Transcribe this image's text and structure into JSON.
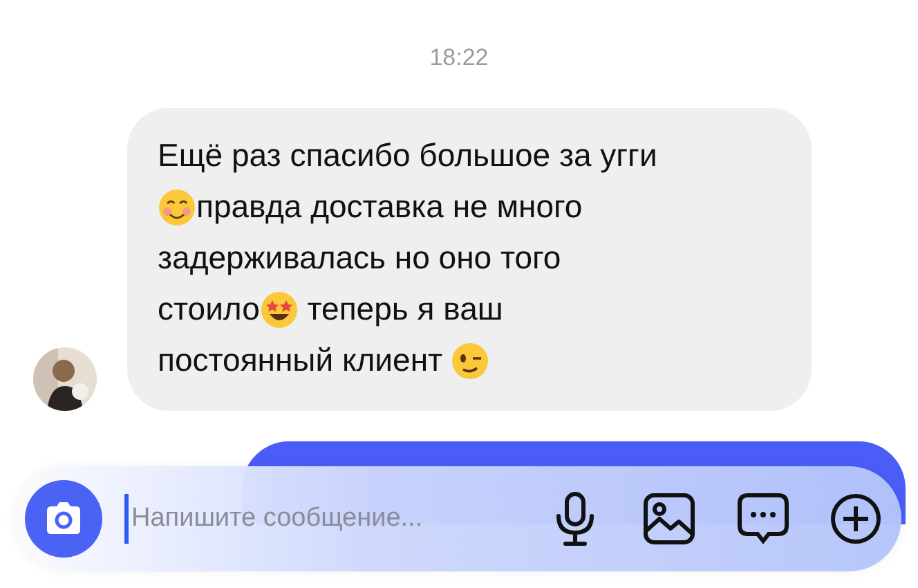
{
  "timestamp": "18:22",
  "incoming": {
    "lines": [
      [
        {
          "kind": "text",
          "text": "Ещё раз спасибо большое за угги"
        }
      ],
      [
        {
          "kind": "blush"
        },
        {
          "kind": "text",
          "text": "правда доставка не много"
        }
      ],
      [
        {
          "kind": "text",
          "text": "задерживалась но оно того"
        }
      ],
      [
        {
          "kind": "text",
          "text": "стоило"
        },
        {
          "kind": "starstruck"
        },
        {
          "kind": "text",
          "text": " теперь я ваш"
        }
      ],
      [
        {
          "kind": "text",
          "text": "постоянный клиент "
        },
        {
          "kind": "wink"
        }
      ]
    ]
  },
  "composer": {
    "placeholder": "Напишите сообщение..."
  }
}
